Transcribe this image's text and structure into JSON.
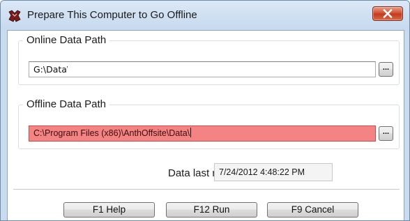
{
  "window": {
    "title": "Prepare This Computer to Go Offline",
    "close_icon": "close-x-icon",
    "app_icon": "app-logo-icon"
  },
  "online": {
    "legend": "Online Data Path",
    "value": "G:\\Data\\",
    "browse_label": "..."
  },
  "offline": {
    "legend": "Offline Data Path",
    "value": "C:\\Program Files (x86)\\AnthOffsite\\Data\\",
    "browse_label": "..."
  },
  "refresh": {
    "label": "Data last refreshed",
    "value": "7/24/2012 4:48:22 PM"
  },
  "buttons": {
    "help": "F1 Help",
    "run": "F12 Run",
    "cancel": "F9 Cancel"
  },
  "colors": {
    "offline_field_bg": "#f48383",
    "close_button": "#c0391c",
    "title_bar": "#c6d9ee"
  }
}
